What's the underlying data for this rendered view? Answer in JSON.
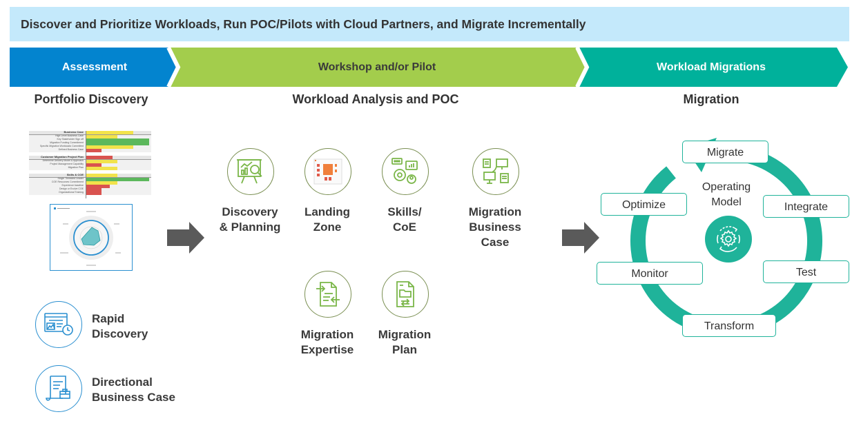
{
  "banner": {
    "title": "Discover and Prioritize Workloads, Run POC/Pilots with Cloud Partners, and Migrate Incrementally"
  },
  "colors": {
    "banner_bg": "#c4e9fb",
    "assessment": "#0384cf",
    "workshop": "#a3cd4c",
    "migrations": "#00b19b",
    "green_icon": "#7ab648",
    "blue_icon": "#2a8fd0",
    "teal": "#1fb39a",
    "arrow_gray": "#5a5a5a"
  },
  "phases": [
    {
      "label": "Assessment",
      "title": "Portfolio Discovery"
    },
    {
      "label": "Workshop and/or Pilot",
      "title": "Workload Analysis and POC"
    },
    {
      "label": "Workload Migrations",
      "title": "Migration"
    }
  ],
  "portfolio": {
    "scorecard": {
      "sections": [
        {
          "header": "Business Case",
          "header_value": "3.0",
          "rows": [
            {
              "label": "High Level Business Case",
              "value": "2.0",
              "status": "yellow"
            },
            {
              "label": "Key Stakeholder Sign off",
              "value": "4.0",
              "status": "green"
            },
            {
              "label": "Migration Funding Commitment",
              "value": "4.0",
              "status": "green"
            },
            {
              "label": "Specific Migration Workloads Committed",
              "value": "3.0",
              "status": "yellow"
            },
            {
              "label": "Defined Business Case",
              "value": "1.0",
              "status": "red"
            }
          ]
        },
        {
          "header": "Customer Migration Project Plan",
          "header_value": "1.7",
          "rows": [
            {
              "label": "Determine Delivery Model & Approach",
              "value": "2.0",
              "status": "yellow"
            },
            {
              "label": "Project Management Capability",
              "value": "1.0",
              "status": "red"
            },
            {
              "label": "Migration Plan",
              "value": "2.0",
              "status": "yellow"
            }
          ]
        },
        {
          "header": "Skills & COE",
          "header_value": "2.0",
          "rows": [
            {
              "label": "Single Threaded Leader",
              "value": "4.0",
              "status": "green"
            },
            {
              "label": "COE Resources Commitment",
              "value": "2.0",
              "status": "yellow"
            },
            {
              "label": "Experience baseline",
              "value": "1.5",
              "status": "red"
            },
            {
              "label": "Design or Evolve COE",
              "value": "1.0",
              "status": "red"
            },
            {
              "label": "Organizational Training",
              "value": "1.0",
              "status": "red"
            }
          ]
        }
      ]
    },
    "items": [
      {
        "label_line1": "Rapid",
        "label_line2": "Discovery",
        "icon": "dashboard-timer-icon"
      },
      {
        "label_line1": "Directional",
        "label_line2": "Business Case",
        "icon": "document-briefcase-icon"
      }
    ]
  },
  "workload_analysis": {
    "items": [
      {
        "lines": [
          "Discovery",
          "& Planning"
        ],
        "icon": "presentation-analysis-icon"
      },
      {
        "lines": [
          "Landing",
          "Zone"
        ],
        "icon": "architecture-diagram-icon"
      },
      {
        "lines": [
          "Skills/",
          "CoE"
        ],
        "icon": "skills-gear-icon"
      },
      {
        "lines": [
          "Migration",
          "Business",
          "Case"
        ],
        "icon": "network-computers-icon"
      },
      {
        "lines": [
          "Migration",
          "Expertise"
        ],
        "icon": "document-transfer-icon"
      },
      {
        "lines": [
          "Migration",
          "Plan"
        ],
        "icon": "folder-plan-icon"
      }
    ]
  },
  "migration": {
    "center": {
      "line1": "Operating",
      "line2": "Model",
      "icon": "gear-cycle-icon"
    },
    "steps": [
      "Migrate",
      "Integrate",
      "Test",
      "Transform",
      "Monitor",
      "Optimize"
    ]
  }
}
